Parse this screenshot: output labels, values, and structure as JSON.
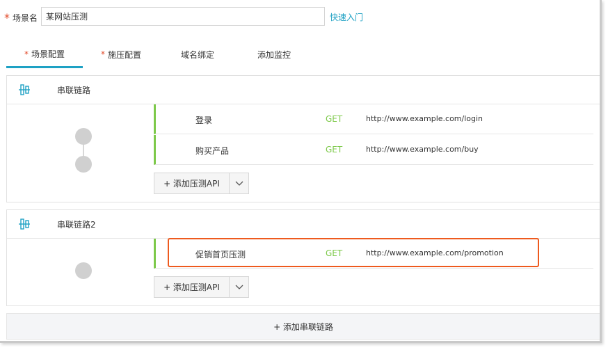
{
  "scene": {
    "required_mark": "*",
    "label": "场景名",
    "value": "某网站压测",
    "quick_link": "快速入门"
  },
  "tabs": [
    {
      "label": "场景配置",
      "required": "*",
      "active": true
    },
    {
      "label": "施压配置",
      "required": "*",
      "active": false
    },
    {
      "label": "域名绑定",
      "required": "",
      "active": false
    },
    {
      "label": "添加监控",
      "required": "",
      "active": false
    }
  ],
  "chains": [
    {
      "title": "串联链路",
      "apis": [
        {
          "name": "登录",
          "method": "GET",
          "url": "http://www.example.com/login"
        },
        {
          "name": "购买产品",
          "method": "GET",
          "url": "http://www.example.com/buy"
        }
      ],
      "add_api_label": "+ 添加压测API"
    },
    {
      "title": "串联链路2",
      "apis": [
        {
          "name": "促销首页压测",
          "method": "GET",
          "url": "http://www.example.com/promotion"
        }
      ],
      "add_api_label": "+ 添加压测API"
    }
  ],
  "add_chain_label": "+ 添加串联链路",
  "colors": {
    "accent": "#1ea1c4",
    "method": "#7dc94a",
    "required": "#e24a2a",
    "highlight": "#ee5a1e"
  },
  "icons": {
    "chain": "chain-link-icon",
    "dropdown": "chevron-down-icon"
  }
}
